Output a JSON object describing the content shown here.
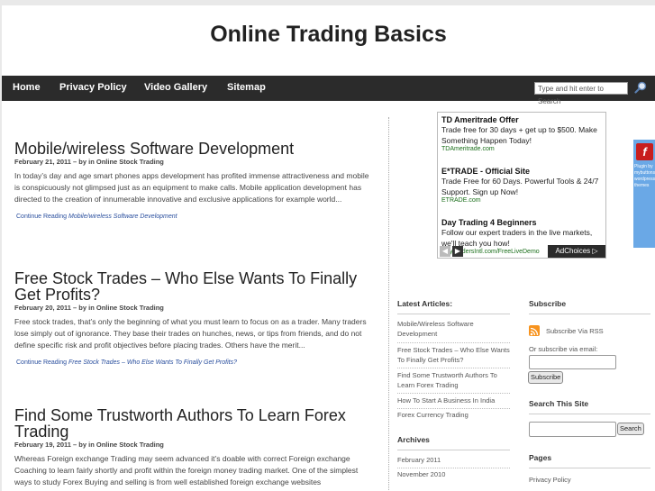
{
  "site": {
    "title": "Online Trading Basics"
  },
  "nav": {
    "items": [
      "Home",
      "Privacy Policy",
      "Video Gallery",
      "Sitemap"
    ],
    "search_placeholder": "Type and hit enter to Search"
  },
  "posts": [
    {
      "title": "Mobile/wireless Software Development",
      "meta": "February 21, 2011 – by in Online Stock Trading",
      "excerpt": "In today’s day and age smart phones apps development has profited immense attractiveness and mobile is conspicuously not glimpsed just as an equipment to make calls. Mobile application development has directed to the creation of innumerable innovative and exclusive applications for example world...",
      "read_more_label": "Continue Reading",
      "read_more_title": "Mobile/wireless Software Development"
    },
    {
      "title": "Free Stock Trades – Who Else Wants To Finally Get Profits?",
      "meta": "February 20, 2011 – by in Online Stock Trading",
      "excerpt": "Free stock trades, that’s only the beginning of what you must learn to focus on as a trader. Many traders lose simply out of ignorance. They base their trades on hunches, news, or tips from friends, and do not define specific risk and profit objectives before placing trades. Others have the merit...",
      "read_more_label": "Continue Reading",
      "read_more_title": "Free Stock Trades – Who Else Wants To Finally Get Profits?"
    },
    {
      "title": "Find Some Trustworth Authors To Learn Forex Trading",
      "meta": "February 19, 2011 – by in Online Stock Trading",
      "excerpt": "Whereas Foreign exchange Trading may seem advanced it’s doable with correct Foreign exchange Coaching to learn fairly shortly and profit within the foreign money trading market. One of the simplest ways to study Forex Buying and selling is from well established foreign exchange websites"
    }
  ],
  "ads": {
    "items": [
      {
        "title": "TD Ameritrade Offer",
        "text": "Trade free for 30 days + get up to $500. Make Something Happen Today!",
        "url": "TDAmeritrade.com"
      },
      {
        "title": "E*TRADE - Official Site",
        "text": "Trade Free for 60 Days. Powerful Tools & 24/7 Support. Sign up Now!",
        "url": "ETRADE.com"
      },
      {
        "title": "Day Trading 4 Beginners",
        "text": "Follow our expert traders in the live markets, we'll teach you how!",
        "url": "DayTradersIntl.com/FreeLiveDemo"
      }
    ],
    "adchoices_label": "AdChoices"
  },
  "sidebar_left": {
    "latest_title": "Latest Articles:",
    "latest": [
      "Mobile/Wireless Software Development",
      "Free Stock Trades – Who Else Wants To Finally Get Profits?",
      "Find Some Trustworth Authors To Learn Forex Trading",
      "How To Start A Business In India",
      "Forex Currency Trading"
    ],
    "archives_title": "Archives",
    "archives": [
      "February 2011",
      "November 2010"
    ]
  },
  "sidebar_right": {
    "subscribe_title": "Subscribe",
    "rss_label": "Subscribe Via RSS",
    "email_label": "Or subscribe via email:",
    "subscribe_button": "Subscribe",
    "search_title": "Search This Site",
    "search_button": "Search",
    "pages_title": "Pages",
    "pages": [
      "Privacy Policy"
    ]
  },
  "flash": {
    "text": "Plugin by mybuttons wordpress themes"
  },
  "colors": {
    "nav_bg": "#2b2b2b",
    "link": "#2a4f9e",
    "ad_url": "#1a6e1a",
    "rss": "#f7931e"
  }
}
